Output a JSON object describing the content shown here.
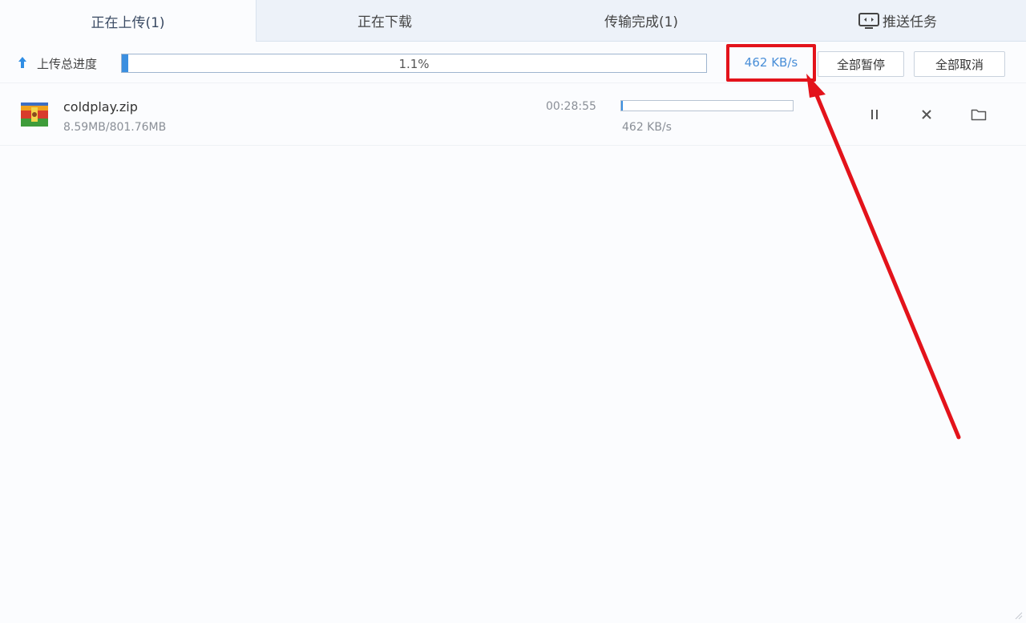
{
  "tabs": [
    {
      "label": "正在上传(1)",
      "active": true
    },
    {
      "label": "正在下载",
      "active": false
    },
    {
      "label": "传输完成(1)",
      "active": false
    },
    {
      "label": "推送任务",
      "active": false,
      "icon": "tv-icon"
    }
  ],
  "progress": {
    "label": "上传总进度",
    "percent_text": "1.1%",
    "percent": 1.1,
    "speed": "462 KB/s",
    "pause_all_label": "全部暂停",
    "cancel_all_label": "全部取消"
  },
  "files": [
    {
      "name": "coldplay.zip",
      "size": "8.59MB/801.76MB",
      "time_left": "00:28:55",
      "speed": "462 KB/s",
      "percent": 1.1,
      "icon": "zip-archive-icon"
    }
  ],
  "colors": {
    "accent": "#3b8fe0",
    "speed_text": "#4a8fd8",
    "annotation_red": "#e3131b"
  }
}
